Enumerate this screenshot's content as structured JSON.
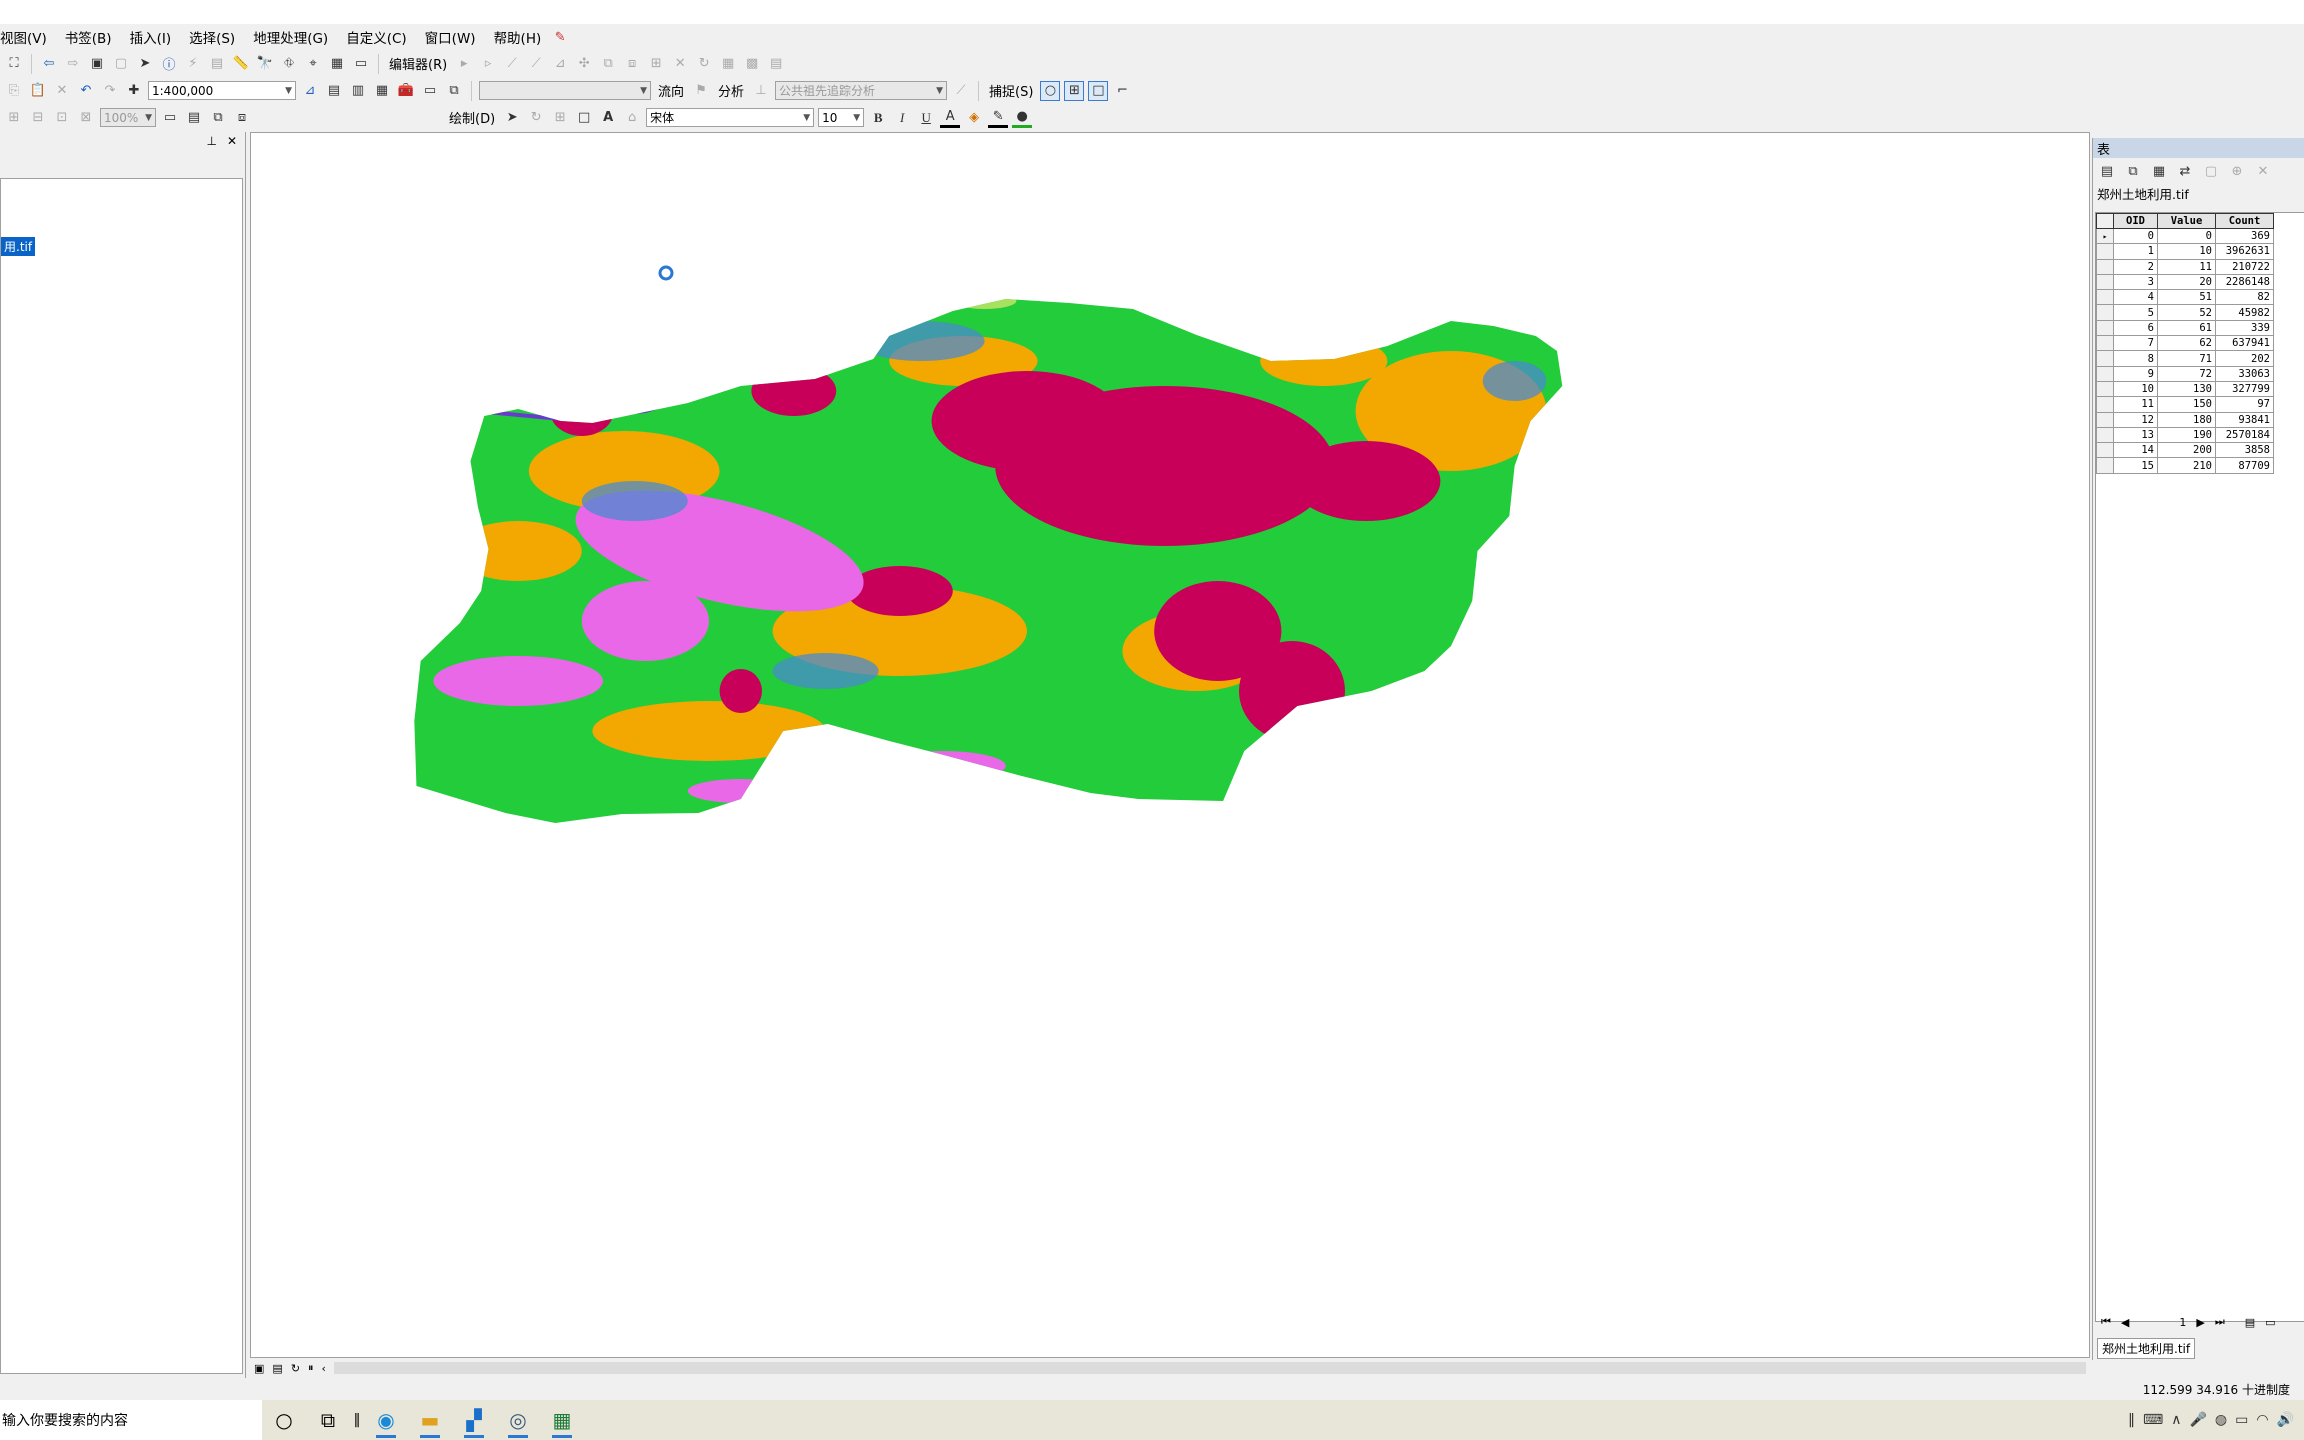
{
  "menubar": {
    "items": [
      "视图(V)",
      "书签(B)",
      "插入(I)",
      "选择(S)",
      "地理处理(G)",
      "自定义(C)",
      "窗口(W)",
      "帮助(H)"
    ]
  },
  "toolbar": {
    "scale_value": "1:400,000",
    "zoom_value": "100%",
    "editor_label": "编辑器(R)",
    "flow_label": "流向",
    "analysis_label": "分析",
    "trace_combo": "公共祖先追踪分析",
    "snapping_label": "捕捉(S)",
    "draw_label": "绘制(D)",
    "font_name": "宋体",
    "font_size": "10",
    "bold": "B",
    "italic": "I",
    "underline": "U"
  },
  "toc": {
    "selected_layer": "用.tif"
  },
  "table_panel": {
    "title": "表",
    "layer_name": "郑州土地利用.tif",
    "tab_label": "郑州土地利用.tif",
    "columns": [
      "OID",
      "Value",
      "Count"
    ],
    "rows": [
      [
        "0",
        "0",
        "369"
      ],
      [
        "1",
        "10",
        "3962631"
      ],
      [
        "2",
        "11",
        "210722"
      ],
      [
        "3",
        "20",
        "2286148"
      ],
      [
        "4",
        "51",
        "82"
      ],
      [
        "5",
        "52",
        "45982"
      ],
      [
        "6",
        "61",
        "339"
      ],
      [
        "7",
        "62",
        "637941"
      ],
      [
        "8",
        "71",
        "202"
      ],
      [
        "9",
        "72",
        "33063"
      ],
      [
        "10",
        "130",
        "327799"
      ],
      [
        "11",
        "150",
        "97"
      ],
      [
        "12",
        "180",
        "93841"
      ],
      [
        "13",
        "190",
        "2570184"
      ],
      [
        "14",
        "200",
        "3858"
      ],
      [
        "15",
        "210",
        "87709"
      ]
    ],
    "current_record": "1"
  },
  "map": {
    "colors": {
      "cropland": "#22cc3a",
      "urban": "#c8005a",
      "shrub": "#f2a800",
      "barren": "#e868e8",
      "forest": "#4a8ad0",
      "water": "#6a3ad0",
      "grass": "#a8e060"
    }
  },
  "status": {
    "coords": "112.599  34.916 十进制度"
  },
  "taskbar": {
    "search_placeholder": "输入你要搜索的内容"
  }
}
